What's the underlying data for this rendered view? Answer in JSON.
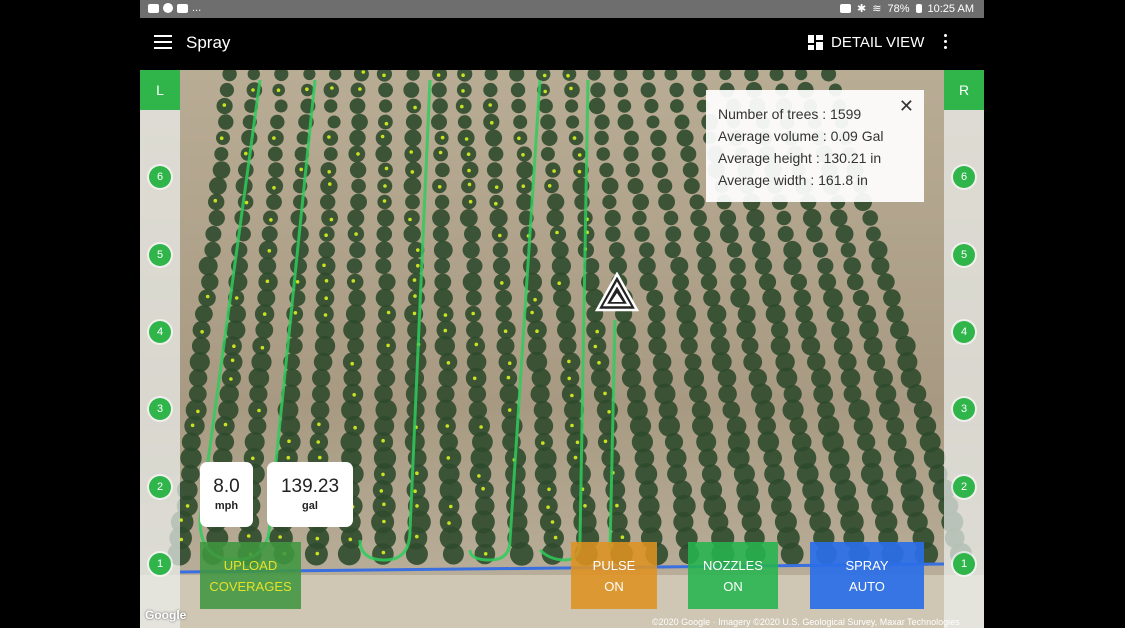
{
  "status_bar": {
    "battery": "78%",
    "time": "10:25 AM",
    "left_text": "..."
  },
  "app_bar": {
    "title": "Spray",
    "detail_view_label": "DETAIL VIEW"
  },
  "rails": {
    "left_label": "L",
    "right_label": "R",
    "numbers": [
      "6",
      "5",
      "4",
      "3",
      "2",
      "1"
    ]
  },
  "info_panel": {
    "trees": "Number of trees : 1599",
    "volume": "Average volume : 0.09 Gal",
    "height": "Average height :  130.21 in",
    "width": "Average width : 161.8 in",
    "close": "✕"
  },
  "readouts": {
    "speed_value": "8.0",
    "speed_unit": "mph",
    "volume_value": "139.23",
    "volume_unit": "gal"
  },
  "buttons": {
    "upload_line1": "UPLOAD",
    "upload_line2": "COVERAGES",
    "pulse_line1": "PULSE",
    "pulse_line2": "ON",
    "nozzles_line1": "NOZZLES",
    "nozzles_line2": "ON",
    "spray_line1": "SPRAY",
    "spray_line2": "AUTO"
  },
  "map": {
    "google_logo": "Google",
    "attribution": "©2020 Google · Imagery ©2020 U.S. Geological Survey, Maxar Technologies",
    "colors": {
      "coverage_line": "#2ecc5a",
      "tree": "#2f4a2c",
      "ground": "#b9ac95"
    }
  }
}
